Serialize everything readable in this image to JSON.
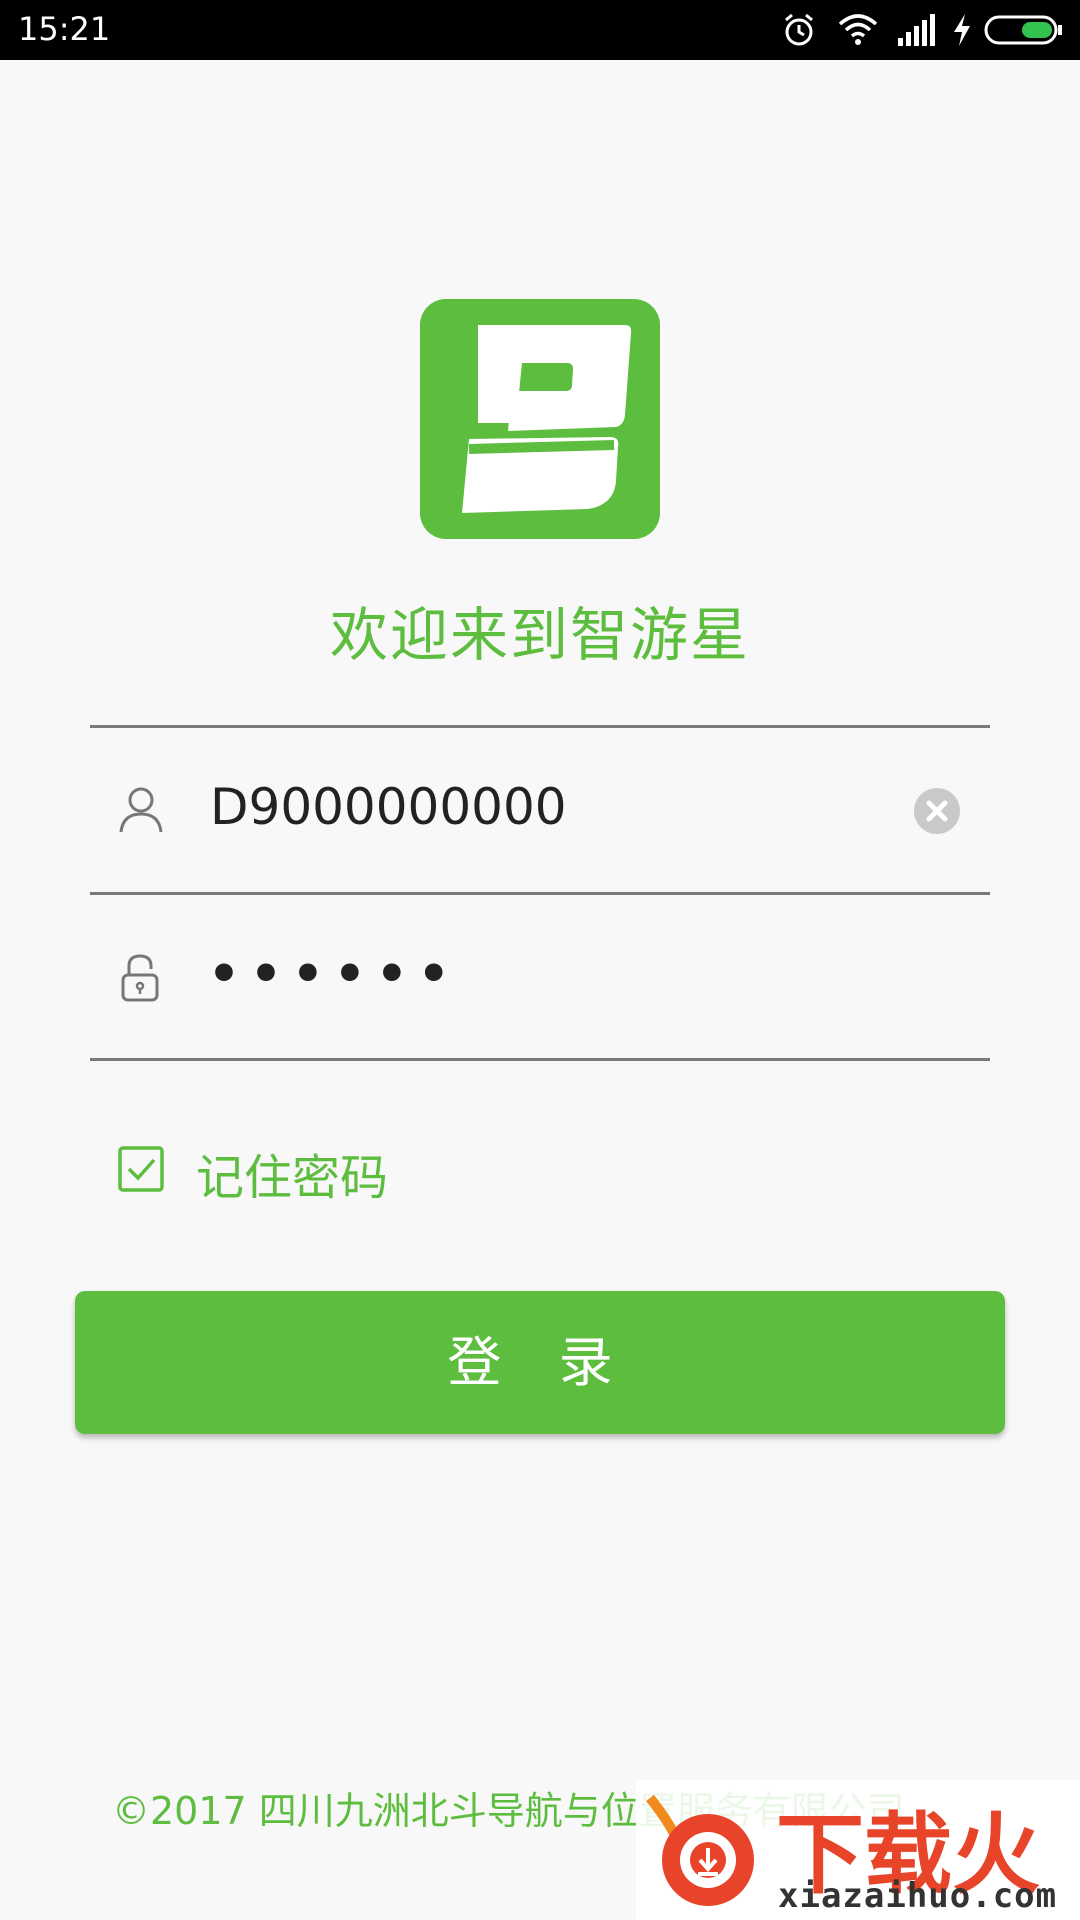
{
  "status_bar": {
    "time": "15:21",
    "icons": [
      "alarm-icon",
      "wifi-icon",
      "signal-icon",
      "charging-icon",
      "battery-icon"
    ]
  },
  "app": {
    "logo_icon": "logo-b-icon",
    "welcome": "欢迎来到智游星"
  },
  "form": {
    "username": {
      "value": "D9000000000",
      "icon": "user-icon",
      "clear_icon": "clear-icon"
    },
    "password": {
      "value": "••••••",
      "icon": "lock-icon"
    },
    "remember": {
      "label": "记住密码",
      "checked": true
    },
    "login_label": "登 录"
  },
  "footer": {
    "copyright": "©2017 四川九洲北斗导航与位置服务有限公司"
  },
  "watermark": {
    "text": "下载火",
    "url": "xiazaihuo.com"
  },
  "colors": {
    "brand": "#5dbd3f",
    "background": "#f8f8f8",
    "status_bar": "#000000"
  }
}
